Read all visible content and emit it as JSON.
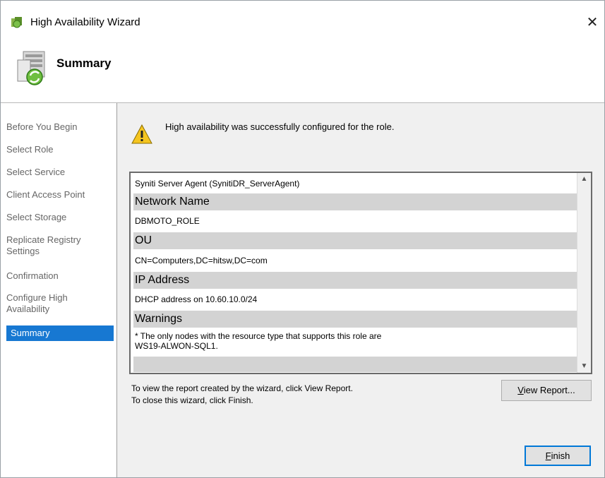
{
  "window": {
    "title": "High Availability Wizard",
    "close_glyph": "✕"
  },
  "header": {
    "title": "Summary",
    "icon": "server-wizard-icon"
  },
  "sidebar": {
    "items": [
      {
        "label": "Before You Begin"
      },
      {
        "label": "Select Role"
      },
      {
        "label": "Select Service"
      },
      {
        "label": "Client Access Point"
      },
      {
        "label": "Select Storage"
      },
      {
        "label": "Replicate Registry\nSettings"
      },
      {
        "label": "Confirmation"
      },
      {
        "label": "Configure High\nAvailability"
      },
      {
        "label": "Summary",
        "selected": true
      }
    ],
    "selected_color": "#1778d2"
  },
  "main": {
    "status_message": "High availability was successfully configured for the role.",
    "status_icon": "warning-icon",
    "report": {
      "role_line": "Syniti Server Agent (SynitiDR_ServerAgent)",
      "network_name_header": "Network Name",
      "network_name_value": "DBMOTO_ROLE",
      "ou_header": "OU",
      "ou_value": "CN=Computers,DC=hitsw,DC=com",
      "ip_header": "IP Address",
      "ip_value": "DHCP address on 10.60.10.0/24",
      "warnings_header": "Warnings",
      "warnings_line1": "* The only nodes with the resource type that supports this role are",
      "warnings_line2": "WS19-ALWON-SQL1."
    },
    "hint_line1": "To view the report created by the wizard, click View Report.",
    "hint_line2": "To close this wizard, click Finish.",
    "view_report_first": "V",
    "view_report_rest": "iew Report...",
    "finish_first": "F",
    "finish_rest": "inish"
  }
}
